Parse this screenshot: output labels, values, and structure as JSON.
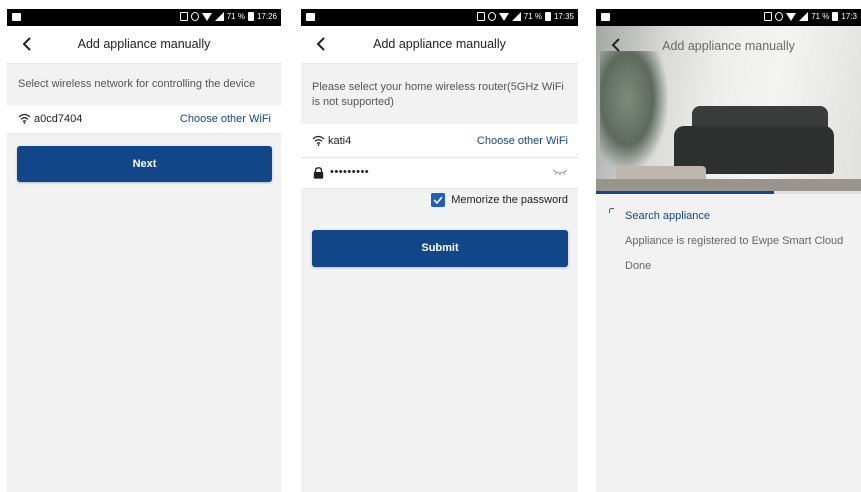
{
  "screens": [
    {
      "status": {
        "battery_text": "71 %",
        "time": "17:26"
      },
      "title": "Add appliance manually",
      "hint": "Select wireless network for controlling the device",
      "ssid": "a0cd7404",
      "choose_other": "Choose other WiFi",
      "button": "Next"
    },
    {
      "status": {
        "battery_text": "71 %",
        "time": "17:35"
      },
      "title": "Add appliance manually",
      "hint": "Please select your home wireless router(5GHz WiFi is not supported)",
      "ssid": "kati4",
      "choose_other": "Choose other WiFi",
      "password_mask": "•••••••••",
      "memorize_label": "Memorize the password",
      "memorize_checked": true,
      "button": "Submit"
    },
    {
      "status": {
        "battery_text": "71 %",
        "time": "17:3"
      },
      "title": "Add appliance manually",
      "progress_fraction": 0.67,
      "steps": [
        {
          "label": "Search appliance",
          "state": "active"
        },
        {
          "label": "Appliance is registered to Ewpe Smart Cloud",
          "state": "pending"
        },
        {
          "label": "Done",
          "state": "pending"
        }
      ]
    }
  ],
  "colors": {
    "primary": "#114789",
    "link": "#154889",
    "background": "#f2f2f2",
    "checkbox": "#1f5fb5"
  },
  "icons": [
    "back-arrow-icon",
    "wifi-icon",
    "lock-icon",
    "eye-hidden-icon",
    "check-icon",
    "image-notification-icon",
    "alarm-icon",
    "signal-icon",
    "battery-icon"
  ]
}
